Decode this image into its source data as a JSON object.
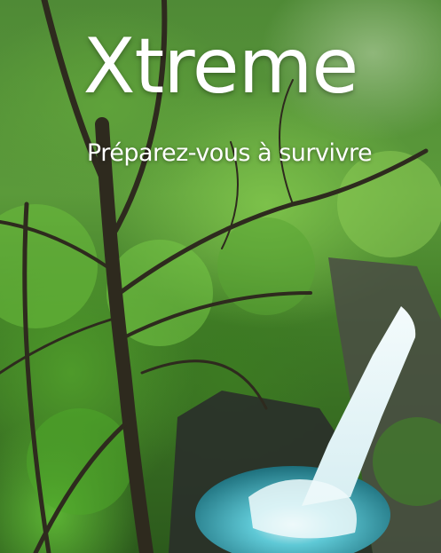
{
  "poster": {
    "title": "Xtreme",
    "subtitle": "Préparez-vous à survivre"
  },
  "colors": {
    "foliage": "#5b9a3a",
    "water": "#3fb7c8",
    "text": "#ffffff"
  }
}
